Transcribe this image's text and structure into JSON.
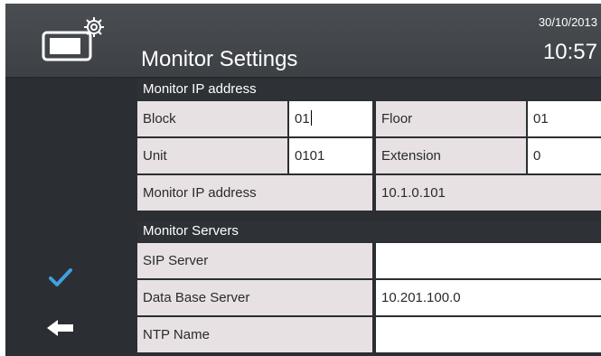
{
  "header": {
    "title": "Monitor Settings",
    "date": "30/10/2013",
    "time": "10:57",
    "icon": "monitor-settings-icon"
  },
  "sidebar": {
    "confirm_icon": "checkmark-icon",
    "back_icon": "arrow-left-icon",
    "accent": "#3ea0e0"
  },
  "ip_section": {
    "title": "Monitor IP address",
    "block_label": "Block",
    "block_value": "01",
    "floor_label": "Floor",
    "floor_value": "01",
    "unit_label": "Unit",
    "unit_value": "0101",
    "extension_label": "Extension",
    "extension_value": "0",
    "ip_label": "Monitor IP address",
    "ip_value": "10.1.0.101"
  },
  "servers_section": {
    "title": "Monitor Servers",
    "sip_label": "SIP Server",
    "sip_value": "",
    "db_label": "Data Base Server",
    "db_value": "10.201.100.0",
    "ntp_label": "NTP Name",
    "ntp_value": ""
  }
}
